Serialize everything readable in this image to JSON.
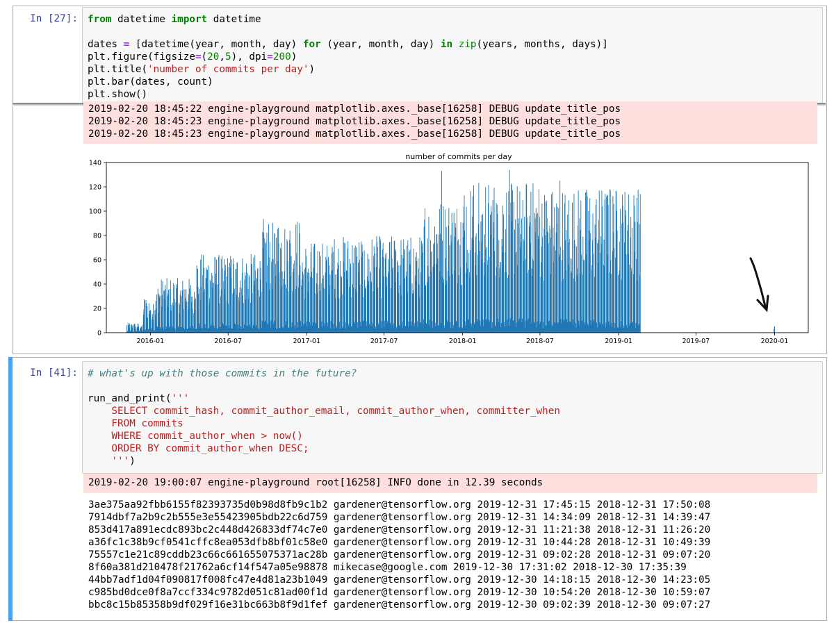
{
  "cell1": {
    "prompt": "In [27]:",
    "code": {
      "l1_kw1": "from",
      "l1_mod": " datetime ",
      "l1_kw2": "import",
      "l1_name": " datetime",
      "l3_a": "dates ",
      "l3_eq": "=",
      "l3_b": " [datetime(year, month, day) ",
      "l3_for": "for",
      "l3_c": " (year, month, day) ",
      "l3_in": "in",
      "l3_sp": " ",
      "l3_zip": "zip",
      "l3_d": "(years, months, days)]",
      "l4_a": "plt.figure(figsize",
      "l4_eq1": "=",
      "l4_b": "(",
      "l4_n1": "20",
      "l4_c": ",",
      "l4_n2": "5",
      "l4_d": "), dpi",
      "l4_eq2": "=",
      "l4_n3": "200",
      "l4_e": ")",
      "l5_a": "plt.title(",
      "l5_str": "'number of commits per day'",
      "l5_b": ")",
      "l6": "plt.bar(dates, count)",
      "l7": "plt.show()"
    },
    "stderr": [
      "2019-02-20 18:45:22 engine-playground matplotlib.axes._base[16258] DEBUG update_title_pos",
      "2019-02-20 18:45:23 engine-playground matplotlib.axes._base[16258] DEBUG update_title_pos",
      "2019-02-20 18:45:23 engine-playground matplotlib.axes._base[16258] DEBUG update_title_pos"
    ]
  },
  "chart_data": {
    "type": "bar",
    "title": "number of commits per day",
    "xlabel": "",
    "ylabel": "",
    "ylim": [
      0,
      140
    ],
    "xlim": [
      "2015-09-20",
      "2020-03-20"
    ],
    "yticks": [
      0,
      20,
      40,
      60,
      80,
      100,
      120,
      140
    ],
    "xticks": [
      "2016-01",
      "2016-07",
      "2017-01",
      "2017-07",
      "2018-01",
      "2018-07",
      "2019-01",
      "2019-07",
      "2020-01"
    ],
    "color": "#1f77b4",
    "grid": false,
    "x_range_main": [
      "2015-11-06",
      "2019-02-20"
    ],
    "weekly_envelope": [
      {
        "from": "2015-11-06",
        "to": "2015-12-15",
        "weekday_max": 8,
        "weekend_max": 2
      },
      {
        "from": "2015-12-15",
        "to": "2016-01-15",
        "weekday_max": 30,
        "weekend_max": 4
      },
      {
        "from": "2016-01-15",
        "to": "2016-04-15",
        "weekday_max": 45,
        "weekend_max": 6
      },
      {
        "from": "2016-04-15",
        "to": "2016-09-15",
        "weekday_max": 65,
        "weekend_max": 8
      },
      {
        "from": "2016-09-15",
        "to": "2016-12-20",
        "weekday_max": 95,
        "weekend_max": 10
      },
      {
        "from": "2016-12-20",
        "to": "2017-03-01",
        "weekday_max": 75,
        "weekend_max": 10
      },
      {
        "from": "2017-03-01",
        "to": "2017-10-01",
        "weekday_max": 80,
        "weekend_max": 10
      },
      {
        "from": "2017-10-01",
        "to": "2018-01-01",
        "weekday_max": 110,
        "weekend_max": 12
      },
      {
        "from": "2018-01-01",
        "to": "2018-07-01",
        "weekday_max": 125,
        "weekend_max": 12
      },
      {
        "from": "2018-07-01",
        "to": "2019-02-20",
        "weekday_max": 120,
        "weekend_max": 12
      }
    ],
    "spikes": [
      {
        "date": "2017-11-12",
        "value": 133
      },
      {
        "date": "2018-04-20",
        "value": 134
      },
      {
        "date": "2018-08-16",
        "value": 125
      },
      {
        "date": "2018-06-09",
        "value": 116
      },
      {
        "date": "2018-12-11",
        "value": 118
      }
    ],
    "future_bars": [
      {
        "date": "2019-12-30",
        "value": 3
      },
      {
        "date": "2019-12-31",
        "value": 5
      }
    ],
    "annotation": "hand-drawn arrow pointing at bars near 2020-01"
  },
  "cell2": {
    "prompt": "In [41]:",
    "code": {
      "comment": "# what's up with those commits in the future?",
      "l3_a": "run_and_print(",
      "l3_str": "'''",
      "l4": "    SELECT commit_hash, commit_author_email, commit_author_when, committer_when",
      "l5": "    FROM commits",
      "l6": "    WHERE commit_author_when > now()",
      "l7": "    ORDER BY commit_author_when DESC;",
      "l8_str": "    '''",
      "l8_b": ")"
    },
    "stderr": "2019-02-20 19:00:07 engine-playground root[16258] INFO done in 12.39 seconds",
    "rows": [
      "3ae375aa92fbb6155f82393735d0b98d8fb9c1b2 gardener@tensorflow.org 2019-12-31 17:45:15 2018-12-31 17:50:08",
      "7914dbf7a2b9c2b555e3e55423905bdb22c6d759 gardener@tensorflow.org 2019-12-31 14:34:09 2018-12-31 14:39:47",
      "853d417a891ecdc893bc2c448d426833df74c7e0 gardener@tensorflow.org 2019-12-31 11:21:38 2018-12-31 11:26:20",
      "a36fc1c38b9cf0541cffc8ea053dfb8bf01c58e0 gardener@tensorflow.org 2019-12-31 10:44:28 2018-12-31 10:49:39",
      "75557c1e21c89cddb23c66c661655075371ac28b gardener@tensorflow.org 2019-12-31 09:02:28 2018-12-31 09:07:20",
      "8f60a381d210478f21762a6cf14f547a05e98878 mikecase@google.com 2019-12-30 17:31:02 2018-12-30 17:35:39",
      "44bb7adf1d04f090817f008fc47e4d81a23b1049 gardener@tensorflow.org 2019-12-30 14:18:15 2018-12-30 14:23:05",
      "c985bd0dce0f8a7ccf334c9782d051c81ad00f1d gardener@tensorflow.org 2019-12-30 10:54:20 2018-12-30 10:59:07",
      "bbc8c15b85358b9df029f16e31bc663b8f9d1fef gardener@tensorflow.org 2019-12-30 09:02:39 2018-12-30 09:07:27"
    ]
  }
}
